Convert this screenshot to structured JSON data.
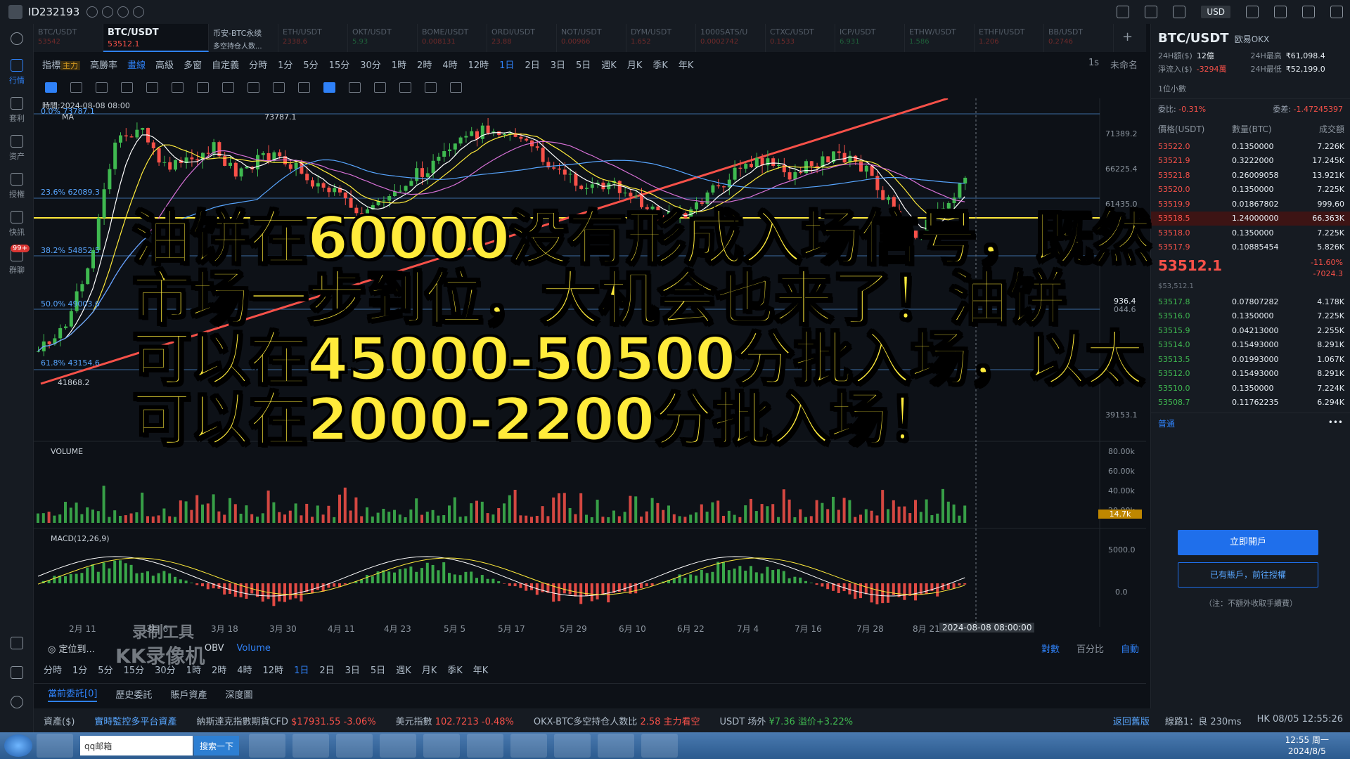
{
  "titlebar": {
    "user_id": "ID232193",
    "currency": "USD"
  },
  "leftnav": [
    {
      "label": "行情",
      "active": true
    },
    {
      "label": "套利"
    },
    {
      "label": "资产"
    },
    {
      "label": "授権"
    },
    {
      "label": "快訊"
    },
    {
      "label": "群聊",
      "badge": "99+"
    }
  ],
  "tabs": [
    {
      "name": "BTC/USDT",
      "price": "53542"
    },
    {
      "name": "BTC/USDT",
      "price": "53512.1",
      "active": true
    },
    {
      "name": "币安-BTC永续",
      "price": "多空持仓人数..."
    },
    {
      "name": "ETH/USDT",
      "price": "2338.6"
    },
    {
      "name": "OKT/USDT",
      "price": "5.93"
    },
    {
      "name": "BOME/USDT",
      "price": "0.008131"
    },
    {
      "name": "ORDI/USDT",
      "price": "23.88"
    },
    {
      "name": "NOT/USDT",
      "price": "0.00966"
    },
    {
      "name": "DYM/USDT",
      "price": "1.652"
    },
    {
      "name": "1000SATS/U",
      "price": "0.0002742"
    },
    {
      "name": "CTXC/USDT",
      "price": "0.1533"
    },
    {
      "name": "ICP/USDT",
      "price": "6.931"
    },
    {
      "name": "ETHW/USDT",
      "price": "1.586"
    },
    {
      "name": "ETHFI/USDT",
      "price": "1.206"
    },
    {
      "name": "BB/USDT",
      "price": "0.2746"
    }
  ],
  "toolbar1": {
    "buttons": [
      "指標",
      "高勝率",
      "畫線",
      "高級",
      "多窗",
      "自定義"
    ],
    "main_tag": "主力",
    "timeframes": [
      "分時",
      "1分",
      "5分",
      "15分",
      "30分",
      "1時",
      "2時",
      "4時",
      "12時",
      "1日",
      "2日",
      "3日",
      "5日",
      "週K",
      "月K",
      "季K",
      "年K"
    ],
    "selected_tf": "1日",
    "right": [
      "1s",
      "未命名"
    ]
  },
  "chart": {
    "time_label": "時間:2024-08-08 08:00",
    "ma_label": "MA",
    "y_labels": [
      "71389.2",
      "66225.4",
      "61435.0",
      "39153.1"
    ],
    "price_tag": "936.4",
    "price_tag2": "044.6",
    "fib_levels": [
      "23.6% 62089.3",
      "38.2% 54852.5",
      "50.0% 49003.6",
      "61.8% 43154.6"
    ],
    "fib_top": "0.0% 73787.1",
    "high_label": "73787.1",
    "low_label": "41868.2",
    "volume_label": "VOLUME",
    "volume_y": [
      "80.00k",
      "60.00k",
      "40.00k",
      "20.00k"
    ],
    "volume_tag": "14.7k",
    "macd_label": "MACD(12,26,9)",
    "macd_y": [
      "5000.0",
      "0.0"
    ],
    "x_labels": [
      "2月 11",
      "3月 6",
      "3月 18",
      "3月 30",
      "4月 11",
      "4月 23",
      "5月 5",
      "5月 17",
      "5月 29",
      "6月 10",
      "6月 22",
      "7月 4",
      "7月 16",
      "7月 28",
      "8月 21"
    ],
    "crosshair_date": "2024-08-08 08:00:00"
  },
  "overlay": {
    "lines": [
      "油饼在60000没有形成入场信号，既然",
      "市场一步到位，大机会也来了！油饼",
      "可以在45000-50500分批入场，以太",
      "可以在2000-2200分批入场！"
    ]
  },
  "watermark": {
    "line1": "录制工具",
    "line2": "KK录像机"
  },
  "indrow": {
    "locate": "定位到...",
    "items": [
      "OBV",
      "Volume"
    ],
    "selected": "Volume",
    "right": [
      "對數",
      "百分比",
      "自動"
    ]
  },
  "tfrow2": [
    "分時",
    "1分",
    "5分",
    "15分",
    "30分",
    "1時",
    "2時",
    "4時",
    "12時",
    "1日",
    "2日",
    "3日",
    "5日",
    "週K",
    "月K",
    "季K",
    "年K"
  ],
  "ordertabs": [
    "當前委託[0]",
    "歷史委託",
    "賬戶資產",
    "深度圖"
  ],
  "statusbar": {
    "asset": "資產($)",
    "monitor": "實時監控多平台資產",
    "nasdaq_label": "納斯達克指數期貨CFD",
    "nasdaq_value": "$17931.55 -3.06%",
    "dxy_label": "美元指數",
    "dxy_value": "102.7213 -0.48%",
    "okx_label": "OKX-BTC多空持仓人数比",
    "okx_value": "2.58 主力看空",
    "usdt_label": "USDT 场外",
    "usdt_value": "¥7.36 溢价+3.22%",
    "back": "返回舊版",
    "line": "線路1：良 230ms",
    "time": "HK 08/05 12:55:26"
  },
  "rightpanel": {
    "symbol": "BTC/USDT",
    "exchange": "欧易OKX",
    "stats": [
      {
        "k": "24H額($)",
        "v": "12億"
      },
      {
        "k": "24H最高",
        "v": "₹61,098.4"
      },
      {
        "k": "淨流入($)",
        "v": "-3294萬",
        "red": true
      },
      {
        "k": "24H最低",
        "v": "₹52,199.0"
      }
    ],
    "decimals": "1位小數",
    "ratio_label": "委比:",
    "ratio_value": "-0.31%",
    "diff_label": "委差:",
    "diff_value": "-1.47245397",
    "ob_head": [
      "價格(USDT)",
      "數量(BTC)",
      "成交額"
    ],
    "asks": [
      [
        "53522.0",
        "0.1350000",
        "7.226K"
      ],
      [
        "53521.9",
        "0.3222000",
        "17.245K"
      ],
      [
        "53521.8",
        "0.26009058",
        "13.921K"
      ],
      [
        "53520.0",
        "0.1350000",
        "7.225K"
      ],
      [
        "53519.9",
        "0.01867802",
        "999.60"
      ],
      [
        "53518.5",
        "1.24000000",
        "66.363K"
      ],
      [
        "53518.0",
        "0.1350000",
        "7.225K"
      ],
      [
        "53517.9",
        "0.10885454",
        "5.826K"
      ]
    ],
    "mid_price": "53512.1",
    "mid_sub": "$53,512.1",
    "mid_chg": "-11.60%",
    "mid_chg2": "-7024.3",
    "bids": [
      [
        "53517.8",
        "0.07807282",
        "4.178K"
      ],
      [
        "53516.0",
        "0.1350000",
        "7.225K"
      ],
      [
        "53515.9",
        "0.04213000",
        "2.255K"
      ],
      [
        "53514.0",
        "0.15493000",
        "8.291K"
      ],
      [
        "53513.5",
        "0.01993000",
        "1.067K"
      ],
      [
        "53512.0",
        "0.15493000",
        "8.291K"
      ],
      [
        "53510.0",
        "0.1350000",
        "7.224K"
      ],
      [
        "53508.7",
        "0.11762235",
        "6.294K"
      ]
    ],
    "tab_normal": "普通",
    "open_account": "立即開戶",
    "have_account": "已有賬戶，前往授權",
    "note": "（注：不額外收取手續費）"
  },
  "taskbar": {
    "search_placeholder": "qq邮箱",
    "search_btn": "搜索一下",
    "time": "12:55 周一",
    "date": "2024/8/5"
  }
}
